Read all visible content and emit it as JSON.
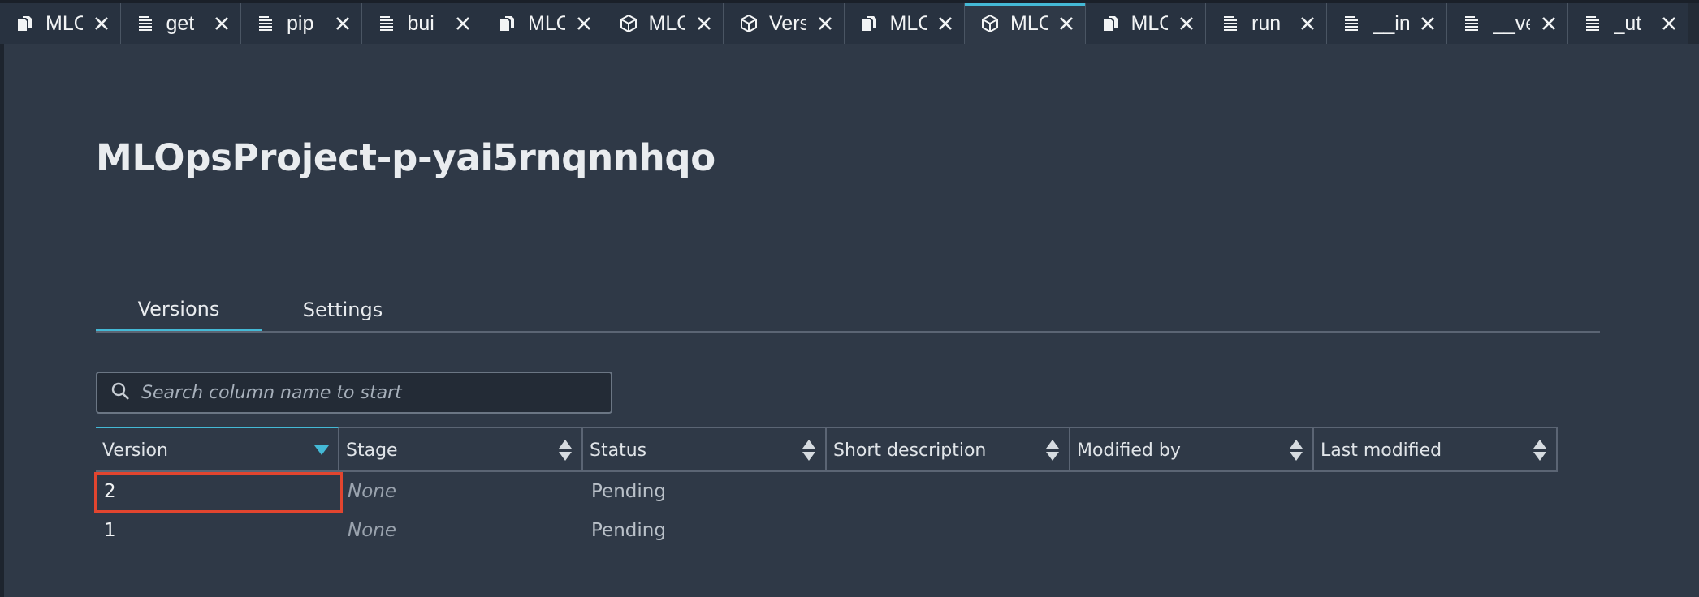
{
  "tabs": [
    {
      "label": "MLOps",
      "icon": "document-stack-icon",
      "active": false
    },
    {
      "label": "get",
      "icon": "text-file-icon",
      "active": false
    },
    {
      "label": "pip",
      "icon": "text-file-icon",
      "active": false
    },
    {
      "label": "bui",
      "icon": "text-file-icon",
      "active": false
    },
    {
      "label": "MLOps",
      "icon": "document-stack-icon",
      "active": false
    },
    {
      "label": "MLOps",
      "icon": "cube-icon",
      "active": false
    },
    {
      "label": "Versions",
      "icon": "cube-icon",
      "active": false
    },
    {
      "label": "MLOps",
      "icon": "document-stack-icon",
      "active": false
    },
    {
      "label": "MLOps",
      "icon": "cube-icon",
      "active": true
    },
    {
      "label": "MLOps",
      "icon": "document-stack-icon",
      "active": false
    },
    {
      "label": "run",
      "icon": "text-file-icon",
      "active": false
    },
    {
      "label": "__init",
      "icon": "text-file-icon",
      "active": false
    },
    {
      "label": "__version",
      "icon": "text-file-icon",
      "active": false
    },
    {
      "label": "_ut",
      "icon": "text-file-icon",
      "active": false
    }
  ],
  "page": {
    "title": "MLOpsProject-p-yai5rnqnnhqo"
  },
  "subtabs": {
    "versions": "Versions",
    "settings": "Settings"
  },
  "search": {
    "placeholder": "Search column name to start"
  },
  "table": {
    "columns": [
      "Version",
      "Stage",
      "Status",
      "Short description",
      "Modified by",
      "Last modified"
    ],
    "sorted_column": "Version",
    "rows": [
      {
        "version": "2",
        "stage": "None",
        "status": "Pending",
        "short_description": "",
        "modified_by": "",
        "last_modified": ""
      },
      {
        "version": "1",
        "stage": "None",
        "status": "Pending",
        "short_description": "",
        "modified_by": "",
        "last_modified": ""
      }
    ],
    "highlighted_row": 0
  },
  "colors": {
    "background": "#2f3947",
    "accent": "#44b9d6",
    "highlight": "#e2452f"
  }
}
